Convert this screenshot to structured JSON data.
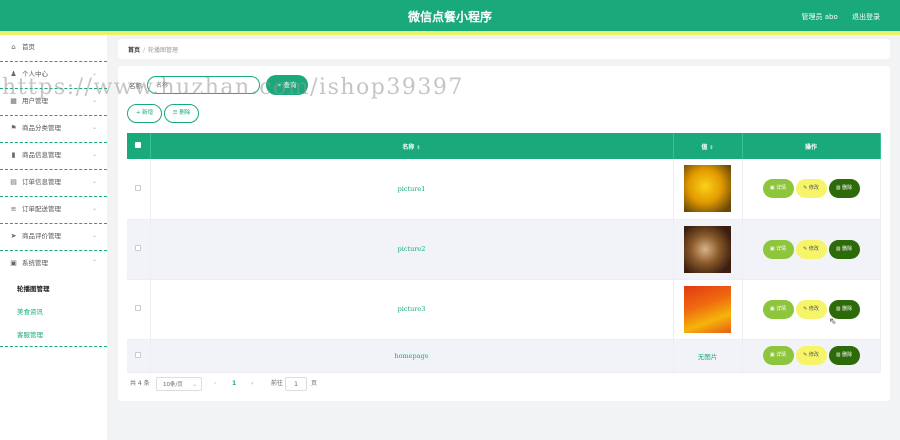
{
  "header": {
    "title": "微信点餐小程序",
    "admin": "管理员 abo",
    "logout": "退出登录"
  },
  "sidebar": {
    "items": [
      {
        "label": "首页",
        "icon": "home-icon",
        "glyph": "⌂",
        "has_chevron": false
      },
      {
        "label": "个人中心",
        "icon": "user-icon",
        "glyph": "♟",
        "has_chevron": true
      },
      {
        "label": "用户管理",
        "icon": "grid-icon",
        "glyph": "▦",
        "has_chevron": true
      },
      {
        "label": "商品分类管理",
        "icon": "flag-icon",
        "glyph": "⚑",
        "has_chevron": true
      },
      {
        "label": "商品信息管理",
        "icon": "chart-icon",
        "glyph": "▮",
        "has_chevron": true
      },
      {
        "label": "订单信息管理",
        "icon": "order-icon",
        "glyph": "▤",
        "has_chevron": true
      },
      {
        "label": "订单配送管理",
        "icon": "sliders-icon",
        "glyph": "≡",
        "has_chevron": true
      },
      {
        "label": "商品评价管理",
        "icon": "send-icon",
        "glyph": "➤",
        "has_chevron": true
      },
      {
        "label": "系统管理",
        "icon": "system-icon",
        "glyph": "▣",
        "has_chevron": true
      }
    ],
    "sub_items": [
      "轮播图管理",
      "美食资讯",
      "客服管理"
    ]
  },
  "breadcrumb": {
    "home": "首页",
    "sep": "/",
    "current": "轮播图管理"
  },
  "search": {
    "label": "名称",
    "placeholder": "名称",
    "button": "查询"
  },
  "actions": {
    "add": "新增",
    "delete": "删除"
  },
  "watermark": "https://www.huzhan.com/ishop39397",
  "table": {
    "columns": [
      "名称",
      "值",
      "操作"
    ],
    "rows": [
      {
        "name": "picture1",
        "value": "image"
      },
      {
        "name": "picture2",
        "value": "image"
      },
      {
        "name": "picture3",
        "value": "image"
      },
      {
        "name": "homepage",
        "value": "无图片"
      }
    ],
    "ops": {
      "detail": "详情",
      "edit": "修改",
      "delete": "删除"
    }
  },
  "pagination": {
    "total": "共 4 条",
    "page_size": "10条/页",
    "current_page": "1",
    "goto_label": "前往",
    "goto_value": "1",
    "page_unit": "页"
  },
  "colors": {
    "primary": "#19a97b",
    "accent_strip": "#e8f26a",
    "detail": "#8dc53c",
    "edit": "#f6f56a",
    "delete": "#2d6a0a"
  }
}
